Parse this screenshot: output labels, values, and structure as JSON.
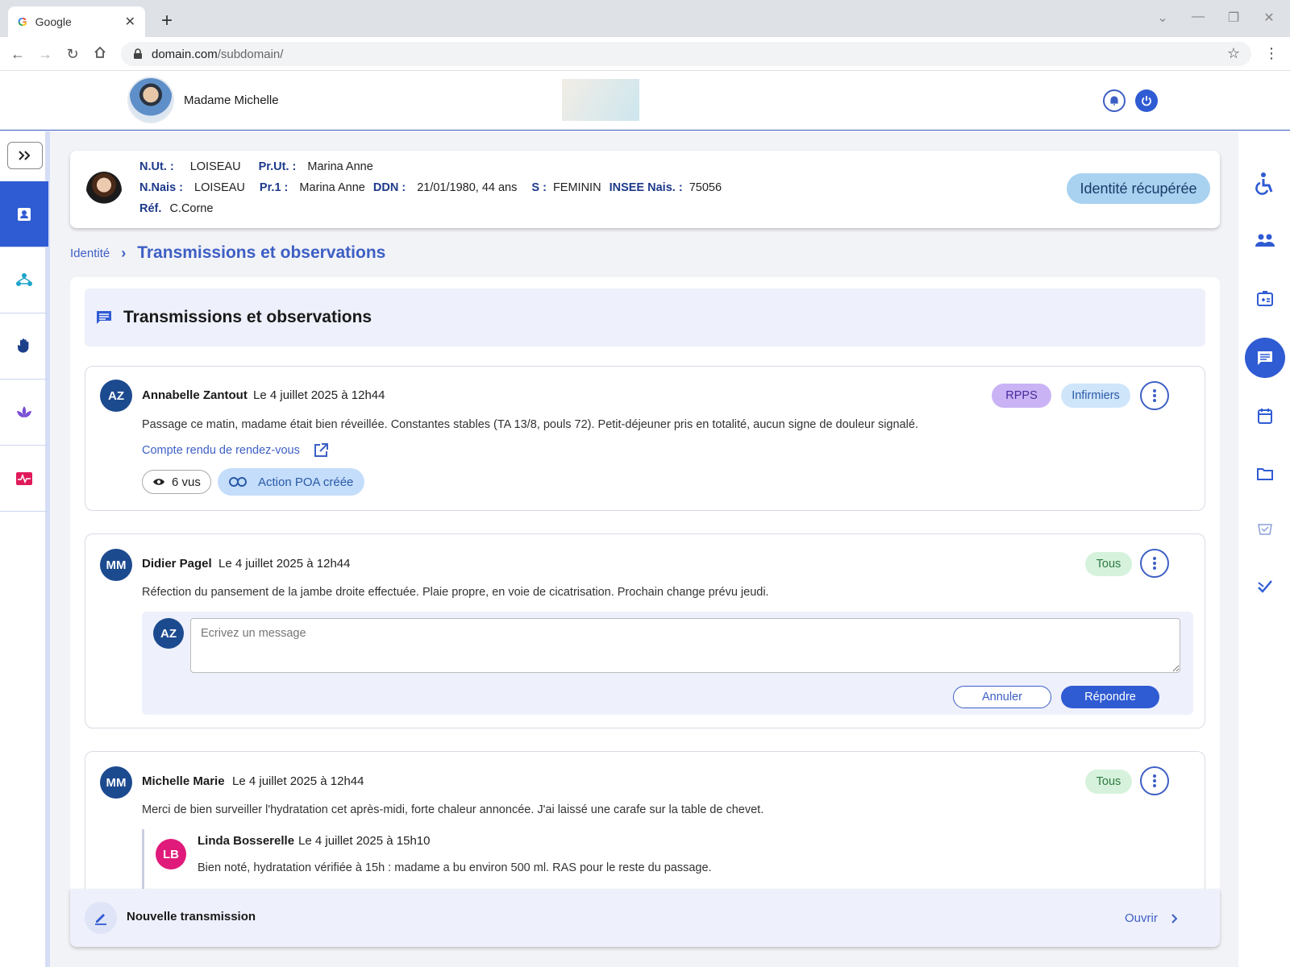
{
  "browser": {
    "tab_title": "Google",
    "tab_logo": "G",
    "new_tab": "+",
    "url_domain": "domain.com",
    "url_path": "/subdomain/"
  },
  "header": {
    "user_name": "Madame Michelle"
  },
  "patient": {
    "nut_label": "N.Ut. :",
    "nut_value": "LOISEAU",
    "prut_label": "Pr.Ut. :",
    "prut_value": "Marina Anne",
    "nnais_label": "N.Nais :",
    "nnais_value": "LOISEAU",
    "pr1_label": "Pr.1 :",
    "pr1_value": "Marina Anne",
    "ddn_label": "DDN :",
    "ddn_value": "21/01/1980, 44 ans",
    "sexe_label": "S :",
    "sexe_value": "FEMININ",
    "insee_label": "INSEE Nais. :",
    "insee_value": "75056",
    "ref_label": "Réf.",
    "ref_value": "C.Corne",
    "identity_status": "Identité récupérée"
  },
  "breadcrumb": {
    "parent": "Identité",
    "current": "Transmissions et observations"
  },
  "section": {
    "title": "Transmissions et observations"
  },
  "messages": [
    {
      "initials": "AZ",
      "author": "Annabelle Zantout",
      "date": "Le 4 juillet 2025 à 12h44",
      "tags": [
        "RPPS",
        "Infirmiers"
      ],
      "text": "Passage ce matin, madame était bien réveillée. Constantes stables (TA 13/8, pouls 72). Petit-déjeuner pris en totalité, aucun signe de douleur signalé.",
      "link": "Compte rendu de rendez-vous",
      "views": "6 vus",
      "action": "Action POA créée"
    },
    {
      "initials": "MM",
      "author": "Didier Pagel",
      "date": "Le 4 juillet 2025 à 12h44",
      "tags": [
        "Tous"
      ],
      "text": "Réfection du pansement de la jambe droite effectuée. Plaie propre, en voie de cicatrisation. Prochain change prévu jeudi.",
      "reply": {
        "initials": "AZ",
        "placeholder": "Ecrivez un message",
        "cancel": "Annuler",
        "submit": "Répondre"
      }
    },
    {
      "initials": "MM",
      "author": "Michelle Marie",
      "date": "Le 4 juillet 2025 à 12h44",
      "tags": [
        "Tous"
      ],
      "text": "Merci de bien surveiller l'hydratation cet après-midi, forte chaleur annoncée. J'ai laissé une carafe sur la table de chevet.",
      "subreply": {
        "initials": "LB",
        "author": "Linda Bosserelle",
        "date": "Le 4 juillet 2025 à 15h10",
        "text": "Bien noté, hydratation vérifiée à 15h : madame a bu environ 500 ml. RAS pour le reste du passage."
      }
    }
  ],
  "footer": {
    "title": "Nouvelle transmission",
    "open": "Ouvrir"
  },
  "colors": {
    "primary": "#2f5bd3",
    "navy": "#1c4a8f",
    "pink": "#e01a7a",
    "panel": "#eef0fb"
  }
}
